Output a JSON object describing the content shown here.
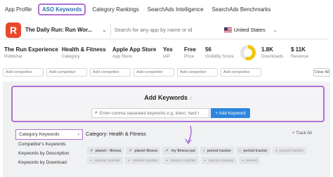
{
  "tabs": [
    "App Profile",
    "ASO Keywords",
    "Category Rankings",
    "SearchAds Intelligence",
    "SearchAds Benchmarks"
  ],
  "active_tab": "ASO Keywords",
  "app": {
    "icon_letter": "R",
    "title": "The Daily Run: Run Wor...",
    "search_placeholder": "Search for any app by name or id",
    "country": "United States"
  },
  "stats": {
    "publisher": {
      "value": "The Run Experience",
      "label": "Publisher"
    },
    "category": {
      "value": "Health & Fitness",
      "label": "Category"
    },
    "store": {
      "value": "Apple App Store",
      "label": "App Store"
    },
    "iap": {
      "value": "Yes",
      "label": "IAP"
    },
    "price": {
      "value": "Free",
      "label": "Price"
    },
    "visibility": {
      "value": "56",
      "label": "Visibility Score",
      "fraction": 0.56
    },
    "downloads": {
      "value": "1.8K",
      "label": "Downloads"
    },
    "revenue": {
      "value": "$ 11K",
      "label": "Revenue"
    }
  },
  "competitors": {
    "add_label": "Add competitor",
    "clear_label": "Clear All"
  },
  "add_keywords": {
    "title": "Add Keywords",
    "info_icon": "i",
    "placeholder": "Enter comma separated keywords e.g. listen, hard r",
    "button": "+ Add Keyword"
  },
  "sidebar": {
    "items": [
      "Category Keywords",
      "Competitor's Keywords",
      "Keywords by Description",
      "Keywords by Download"
    ],
    "active_chevron": "›"
  },
  "category": {
    "title": "Category: Health & Fitness",
    "track_all": "+ Track All"
  },
  "keyword_chips": {
    "row1": [
      "planet - fitness",
      "planet fitness",
      "my fitness pal",
      "period tracker",
      "period tracker"
    ],
    "row2": [
      "period tracker",
      "calorie counter",
      "calorie counter",
      "calorie counter",
      "calorie counter",
      "period"
    ]
  },
  "colors": {
    "accent_purple": "#b070d6",
    "brand_red": "#e8492e",
    "button_blue": "#2b86de",
    "donut_yellow": "#f1c40f"
  }
}
